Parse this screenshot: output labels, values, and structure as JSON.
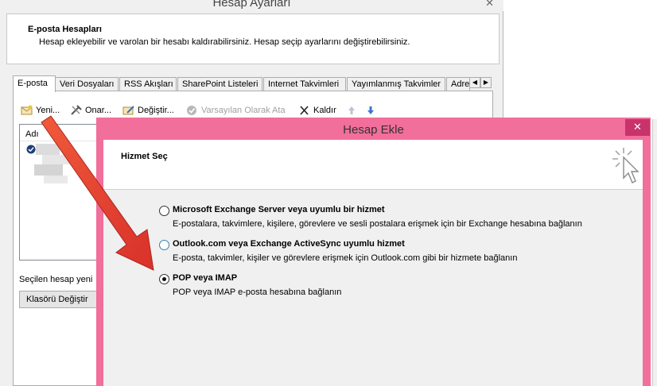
{
  "settings_window": {
    "title": "Hesap Ayarları",
    "close_glyph": "✕",
    "header": {
      "title": "E-posta Hesapları",
      "description": "Hesap ekleyebilir ve varolan bir hesabı kaldırabilirsiniz. Hesap seçip ayarlarını değiştirebilirsiniz."
    },
    "tabs": [
      {
        "label": "E-posta"
      },
      {
        "label": "Veri Dosyaları"
      },
      {
        "label": "RSS Akışları"
      },
      {
        "label": "SharePoint Listeleri"
      },
      {
        "label": "Internet Takvimleri"
      },
      {
        "label": "Yayımlanmış Takvimler"
      },
      {
        "label": "Adre"
      }
    ],
    "tab_scroll": {
      "left": "◀",
      "right": "▶"
    },
    "toolbar": {
      "new_label": "Yeni...",
      "repair_label": "Onar...",
      "change_label": "Değiştir...",
      "set_default_label": "Varsayılan Olarak Ata",
      "remove_label": "Kaldır"
    },
    "account_list": {
      "column_name": "Adı"
    },
    "selected_account_text": "Seçilen hesap yeni",
    "change_folder_button": "Klasörü Değiştir"
  },
  "add_account_dialog": {
    "title": "Hesap Ekle",
    "close_glyph": "✕",
    "section_title": "Hizmet Seç",
    "options": [
      {
        "title": "Microsoft Exchange Server veya uyumlu bir hizmet",
        "description": "E-postalara, takvimlere, kişilere, görevlere ve sesli postalara erişmek için bir Exchange hesabına bağlanın",
        "selected": false
      },
      {
        "title": "Outlook.com veya Exchange ActiveSync uyumlu hizmet",
        "description": "E-posta, takvimler, kişiler ve görevlere erişmek için Outlook.com gibi bir hizmete bağlanın",
        "selected": false
      },
      {
        "title": "POP veya IMAP",
        "description": "POP veya IMAP e-posta hesabına bağlanın",
        "selected": true
      }
    ]
  },
  "colors": {
    "dialog_accent": "#f26e9b",
    "close_button": "#c7336a",
    "annotation_arrow": "#e8412b"
  },
  "icons": {
    "new": "new-account-icon",
    "repair": "repair-icon",
    "change": "change-icon",
    "set_default": "checkmark-icon",
    "remove": "remove-x-icon",
    "up": "move-up-icon",
    "down": "move-down-icon",
    "cursor": "cursor-sparkle-icon"
  }
}
